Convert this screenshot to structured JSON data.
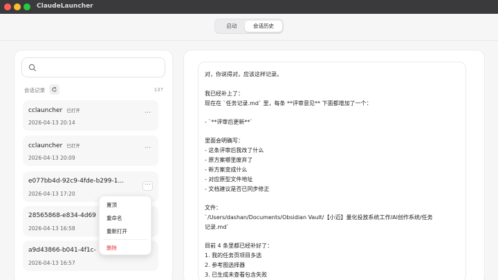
{
  "app": {
    "title": "ClaudeLauncher"
  },
  "tabs": {
    "start": "启动",
    "history": "会话历史"
  },
  "search": {
    "placeholder": ""
  },
  "history": {
    "section_label": "会话记录",
    "count": "137",
    "sessions": [
      {
        "title": "cclauncher",
        "badge": "已打开",
        "date": "2026-04-13 20:14"
      },
      {
        "title": "cclauncher",
        "badge": "已打开",
        "date": "2026-04-13 20:09"
      },
      {
        "title": "e077bb4d-92c9-4fde-b299-1...",
        "badge": "",
        "date": "2026-04-13 17:20"
      },
      {
        "title": "28565868-e834-4d69",
        "badge": "",
        "date": "2026-04-13 16:58"
      },
      {
        "title": "a9d43866-b041-4f1c-",
        "badge": "",
        "date": "2026-04-13 16:57"
      }
    ]
  },
  "context_menu": {
    "items": [
      "置顶",
      "重命名",
      "重新打开"
    ],
    "delete": "删除",
    "delete_color": "#e03b3b"
  },
  "message": {
    "lines": [
      "对，你说得对，应该这样记录。",
      "",
      "我已经补上了：",
      "现在在 `任务记录.md` 里，每条 **评审意见** 下面都增加了一个：",
      "",
      "- `**评审后更新**`",
      "",
      "里面会明确写：",
      "- 这条评审后我改了什么",
      "- 原方案哪里废弃了",
      "- 新方案变成什么",
      "- 对应原型文件地址",
      "- 文档建议是否已同步修正",
      "",
      "文件：",
      "`/Users/dashan/Documents/Obsidian Vault/【小迈】量化投放系统工作/AI创作系统/任务",
      "记录.md`",
      "",
      "目前 4 条里都已经补好了：",
      "1. 我的任务页项目多选",
      "2. 参考图选择器",
      "3. 已生成未查看包含失败"
    ]
  },
  "colors": {
    "accent_red": "#e03b3b",
    "titlebar": "#3a3a3c"
  }
}
